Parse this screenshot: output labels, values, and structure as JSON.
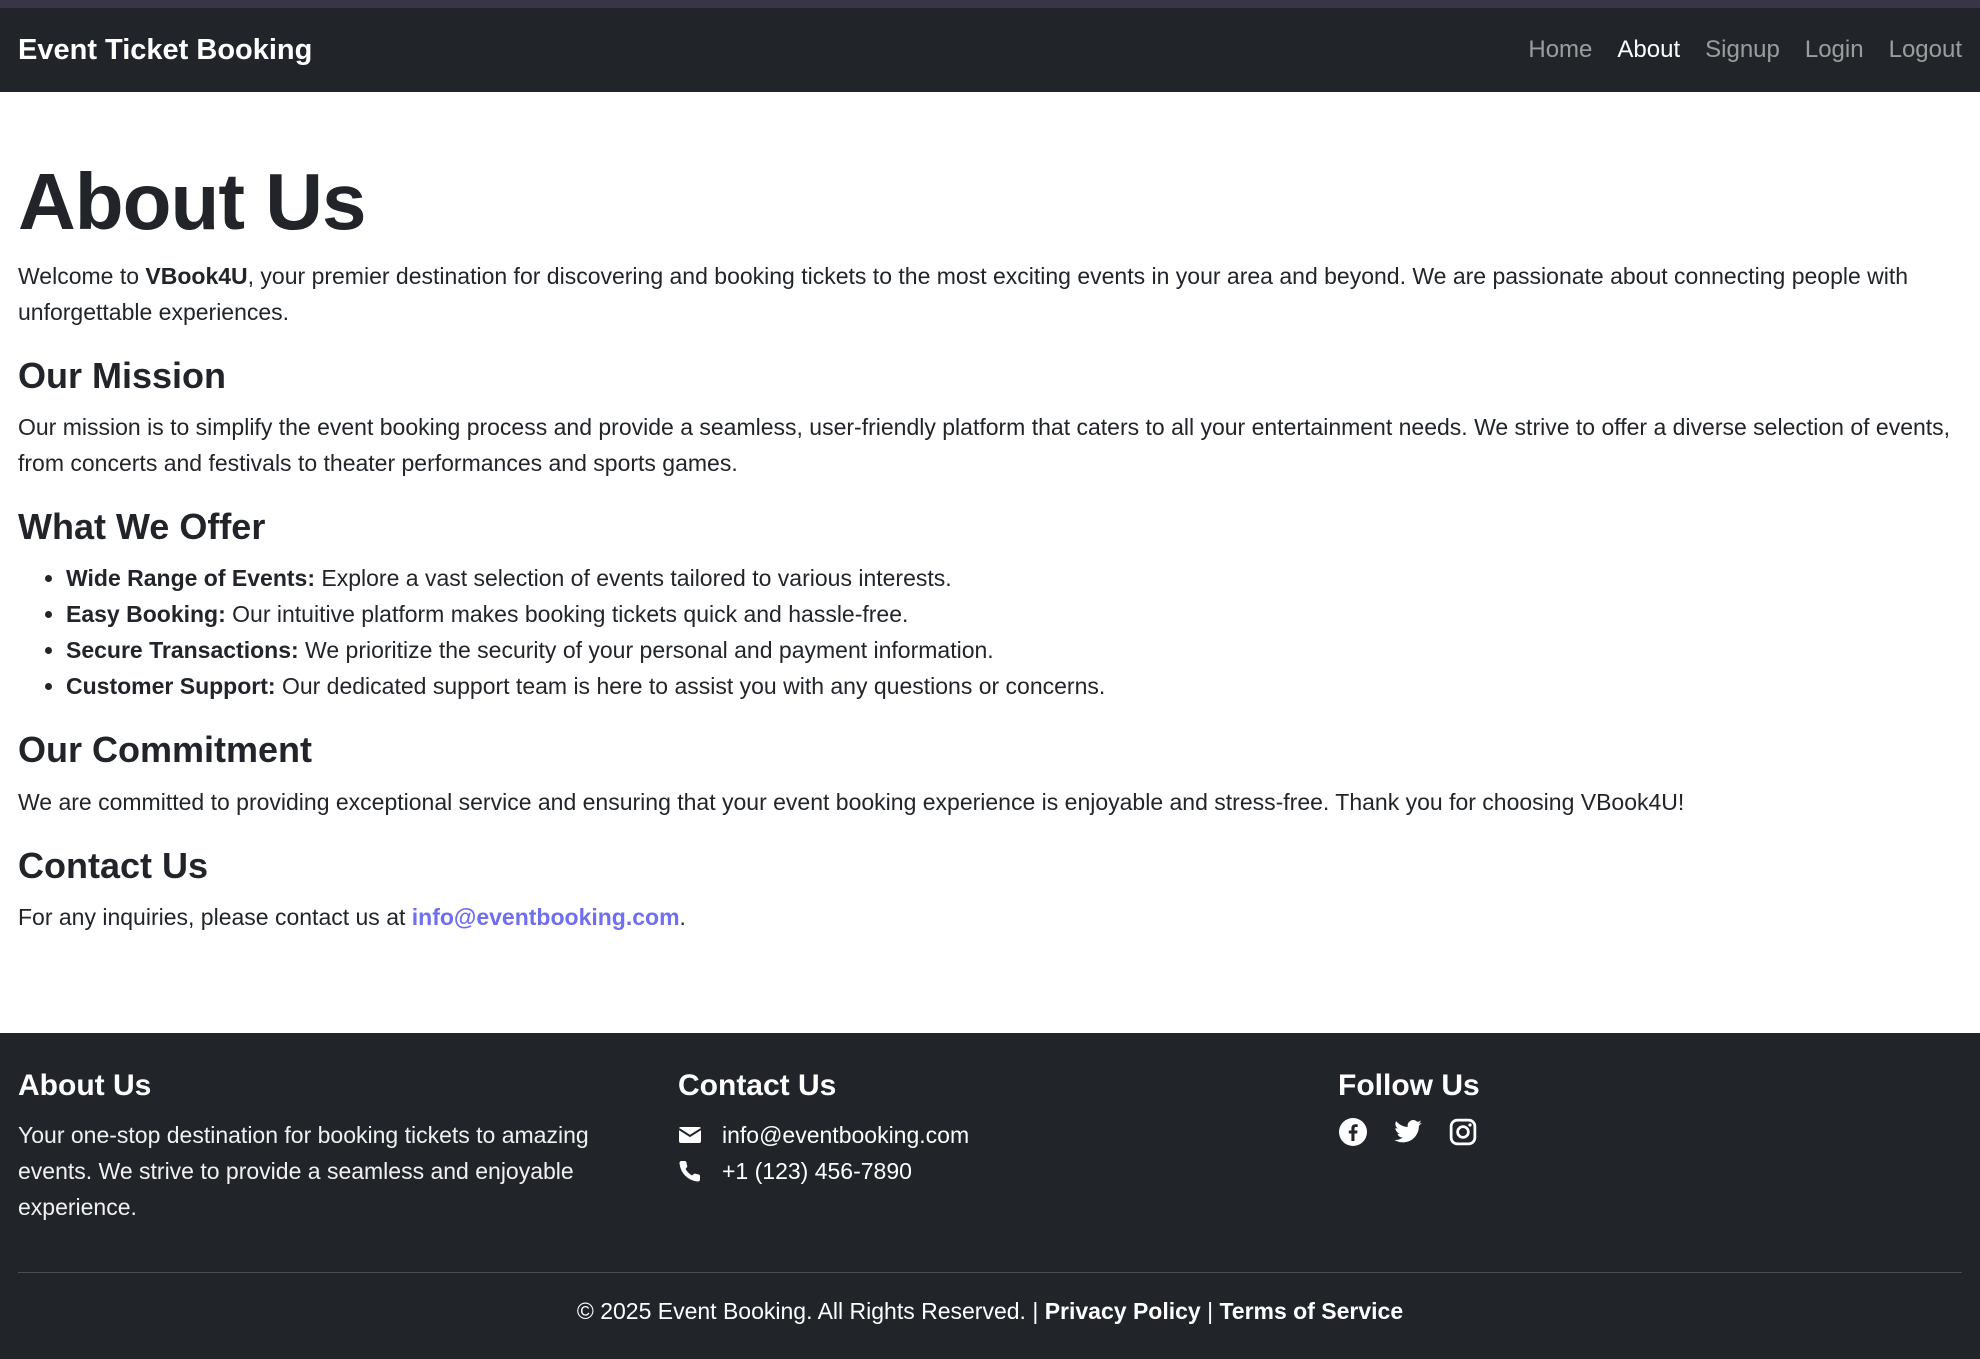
{
  "nav": {
    "brand": "Event Ticket Booking",
    "links": [
      "Home",
      "About",
      "Signup",
      "Login",
      "Logout"
    ],
    "active": "About"
  },
  "main": {
    "title": "About Us",
    "intro_prefix": "Welcome to ",
    "intro_brand": "VBook4U",
    "intro_rest": ", your premier destination for discovering and booking tickets to the most exciting events in your area and beyond. We are passionate about connecting people with unforgettable experiences.",
    "mission_heading": "Our Mission",
    "mission_text": "Our mission is to simplify the event booking process and provide a seamless, user-friendly platform that caters to all your entertainment needs. We strive to offer a diverse selection of events, from concerts and festivals to theater performances and sports games.",
    "offer_heading": "What We Offer",
    "offers": [
      {
        "title": "Wide Range of Events:",
        "text": " Explore a vast selection of events tailored to various interests."
      },
      {
        "title": "Easy Booking:",
        "text": " Our intuitive platform makes booking tickets quick and hassle-free."
      },
      {
        "title": "Secure Transactions:",
        "text": " We prioritize the security of your personal and payment information."
      },
      {
        "title": "Customer Support:",
        "text": " Our dedicated support team is here to assist you with any questions or concerns."
      }
    ],
    "commitment_heading": "Our Commitment",
    "commitment_text": "We are committed to providing exceptional service and ensuring that your event booking experience is enjoyable and stress-free. Thank you for choosing VBook4U!",
    "contact_heading": "Contact Us",
    "contact_prefix": "For any inquiries, please contact us at ",
    "contact_email": "info@eventbooking.com",
    "contact_suffix": "."
  },
  "footer": {
    "about_heading": "About Us",
    "about_text": "Your one-stop destination for booking tickets to amazing events. We strive to provide a seamless and enjoyable experience.",
    "contact_heading": "Contact Us",
    "email": "info@eventbooking.com",
    "phone": "+1 (123) 456-7890",
    "follow_heading": "Follow Us",
    "social_icons": [
      "facebook-icon",
      "twitter-icon",
      "instagram-icon"
    ],
    "copyright": "© 2025 Event Booking. All Rights Reserved. |",
    "privacy": "Privacy Policy",
    "separator": "|",
    "terms": "Terms of Service"
  },
  "colors": {
    "navbar_bg": "#212529",
    "link_accent": "#6f6ff0"
  }
}
